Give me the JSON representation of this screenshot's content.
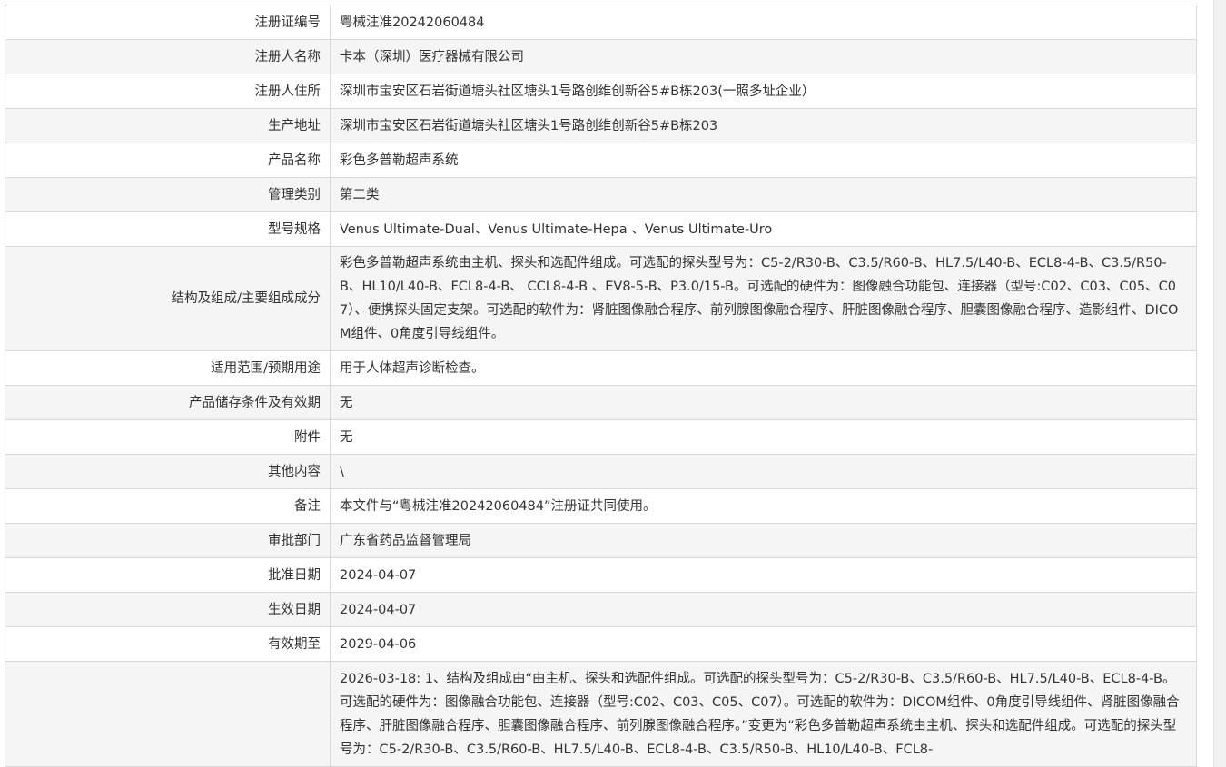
{
  "rows": [
    {
      "label": "注册证编号",
      "value": "粤械注准20242060484"
    },
    {
      "label": "注册人名称",
      "value": "卡本（深圳）医疗器械有限公司"
    },
    {
      "label": "注册人住所",
      "value": "深圳市宝安区石岩街道塘头社区塘头1号路创维创新谷5#B栋203(一照多址企业）"
    },
    {
      "label": "生产地址",
      "value": "深圳市宝安区石岩街道塘头社区塘头1号路创维创新谷5#B栋203"
    },
    {
      "label": "产品名称",
      "value": "彩色多普勒超声系统"
    },
    {
      "label": "管理类别",
      "value": "第二类"
    },
    {
      "label": "型号规格",
      "value": "Venus Ultimate-Dual、Venus Ultimate-Hepa 、Venus Ultimate-Uro"
    },
    {
      "label": "结构及组成/主要组成成分",
      "value": "彩色多普勒超声系统由主机、探头和选配件组成。可选配的探头型号为：C5-2/R30-B、C3.5/R60-B、HL7.5/L40-B、ECL8-4-B、C3.5/R50-B、HL10/L40-B、FCL8-4-B、 CCL8-4-B 、EV8-5-B、P3.0/15-B。可选配的硬件为：图像融合功能包、连接器（型号:C02、C03、C05、C07）、便携探头固定支架。可选配的软件为：肾脏图像融合程序、前列腺图像融合程序、肝脏图像融合程序、胆囊图像融合程序、造影组件、DICOM组件、0角度引导线组件。"
    },
    {
      "label": "适用范围/预期用途",
      "value": "用于人体超声诊断检查。"
    },
    {
      "label": "产品储存条件及有效期",
      "value": "无"
    },
    {
      "label": "附件",
      "value": "无"
    },
    {
      "label": "其他内容",
      "value": "\\"
    },
    {
      "label": "备注",
      "value": "本文件与“粤械注准20242060484”注册证共同使用。"
    },
    {
      "label": "审批部门",
      "value": "广东省药品监督管理局"
    },
    {
      "label": "批准日期",
      "value": "2024-04-07"
    },
    {
      "label": "生效日期",
      "value": "2024-04-07"
    },
    {
      "label": "有效期至",
      "value": "2029-04-06"
    },
    {
      "label": "",
      "value": "2026-03-18: 1、结构及组成由“由主机、探头和选配件组成。可选配的探头型号为：C5-2/R30-B、C3.5/R60-B、HL7.5/L40-B、ECL8-4-B。可选配的硬件为：图像融合功能包、连接器（型号:C02、C03、C05、C07）。可选配的软件为：DICOM组件、0角度引导线组件、肾脏图像融合程序、肝脏图像融合程序、胆囊图像融合程序、前列腺图像融合程序。”变更为“彩色多普勒超声系统由主机、探头和选配件组成。可选配的探头型号为：C5-2/R30-B、C3.5/R60-B、HL7.5/L40-B、ECL8-4-B、C3.5/R50-B、HL10/L40-B、FCL8-"
    }
  ]
}
